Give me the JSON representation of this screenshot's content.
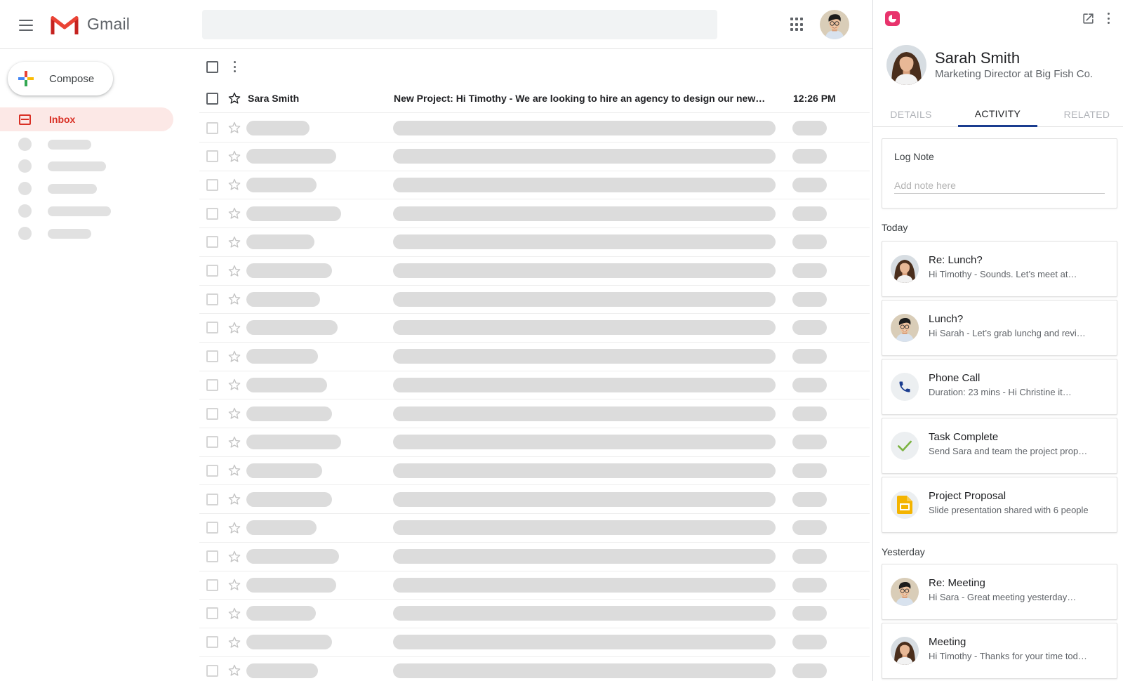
{
  "header": {
    "app_name": "Gmail",
    "menu_icon": "hamburger-menu-icon",
    "apps_icon": "apps-grid-icon",
    "brand_colors": {
      "red": "#EA4335",
      "blue": "#4285F4",
      "yellow": "#FBBC04",
      "green": "#34A853"
    }
  },
  "nav": {
    "compose_label": "Compose",
    "inbox_label": "Inbox",
    "inbox_color": "#D93025"
  },
  "messages": [
    {
      "sender": "Sara Smith",
      "subject": "New Project: Hi Timothy - We are looking to hire an agency to design our new…",
      "time": "12:26 PM"
    }
  ],
  "sidebar": {
    "accent_color": "#E8336C",
    "contact": {
      "name": "Sarah Smith",
      "title": "Marketing Director at Big Fish Co."
    },
    "tabs": [
      {
        "label": "DETAILS",
        "active": false
      },
      {
        "label": "ACTIVITY",
        "active": true
      },
      {
        "label": "RELATED",
        "active": false
      }
    ],
    "log_note": {
      "title": "Log Note",
      "placeholder": "Add note here"
    },
    "sections": [
      {
        "label": "Today",
        "items": [
          {
            "icon": "woman-avatar",
            "title": "Re: Lunch?",
            "subtitle": "Hi Timothy -  Sounds. Let’s meet at…"
          },
          {
            "icon": "man-avatar",
            "title": "Lunch?",
            "subtitle": "Hi Sarah - Let’s grab lunchg and revi…"
          },
          {
            "icon": "phone-icon",
            "title": "Phone Call",
            "subtitle": "Duration: 23 mins -  Hi Christine it…"
          },
          {
            "icon": "checkmark-icon",
            "title": "Task Complete",
            "subtitle": "Send Sara and team the project prop…"
          },
          {
            "icon": "slides-icon",
            "title": "Project Proposal",
            "subtitle": "Slide presentation shared with 6 people"
          }
        ]
      },
      {
        "label": "Yesterday",
        "items": [
          {
            "icon": "man-avatar",
            "title": "Re: Meeting",
            "subtitle": "Hi Sara - Great meeting yesterday…"
          },
          {
            "icon": "woman-avatar",
            "title": "Meeting",
            "subtitle": "Hi Timothy - Thanks for your time tod…"
          }
        ]
      }
    ]
  }
}
